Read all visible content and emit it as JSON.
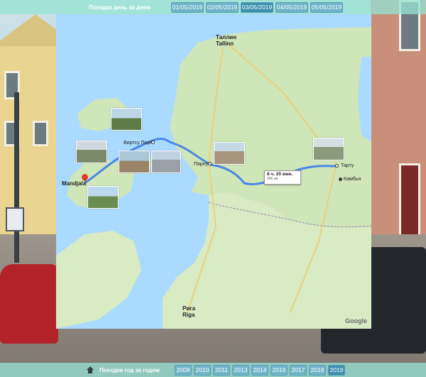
{
  "header": {
    "title": "Поездка день за днем",
    "dates": [
      "01/05/2019",
      "02/05/2019",
      "03/05/2019",
      "04/05/2019",
      "05/05/2019"
    ],
    "active_index": 2
  },
  "footer": {
    "title": "Поездки год за годом",
    "years": [
      "2008",
      "2010",
      "2011",
      "2013",
      "2014",
      "2016",
      "2017",
      "2018",
      "2019"
    ],
    "active_index": 8
  },
  "map": {
    "cities": {
      "tallinn": "Таллин\nTallinn",
      "virtsu": "Виртсу Порт",
      "parnu": "Пярну",
      "tartu": "Тарту",
      "kambja": "Камбья",
      "mandjala": "Mandjala",
      "riga": "Рига\nRiga"
    },
    "route_info": {
      "duration": "6 ч. 20 мин.",
      "distance": "396 км"
    },
    "attribution": "Google"
  },
  "colors": {
    "bar": "#96e1d2",
    "pill": "#6fb3c9",
    "pill_active": "#3c8fae",
    "route": "#4a86e8",
    "land": "#cfe6b8",
    "water": "#aadaff"
  }
}
